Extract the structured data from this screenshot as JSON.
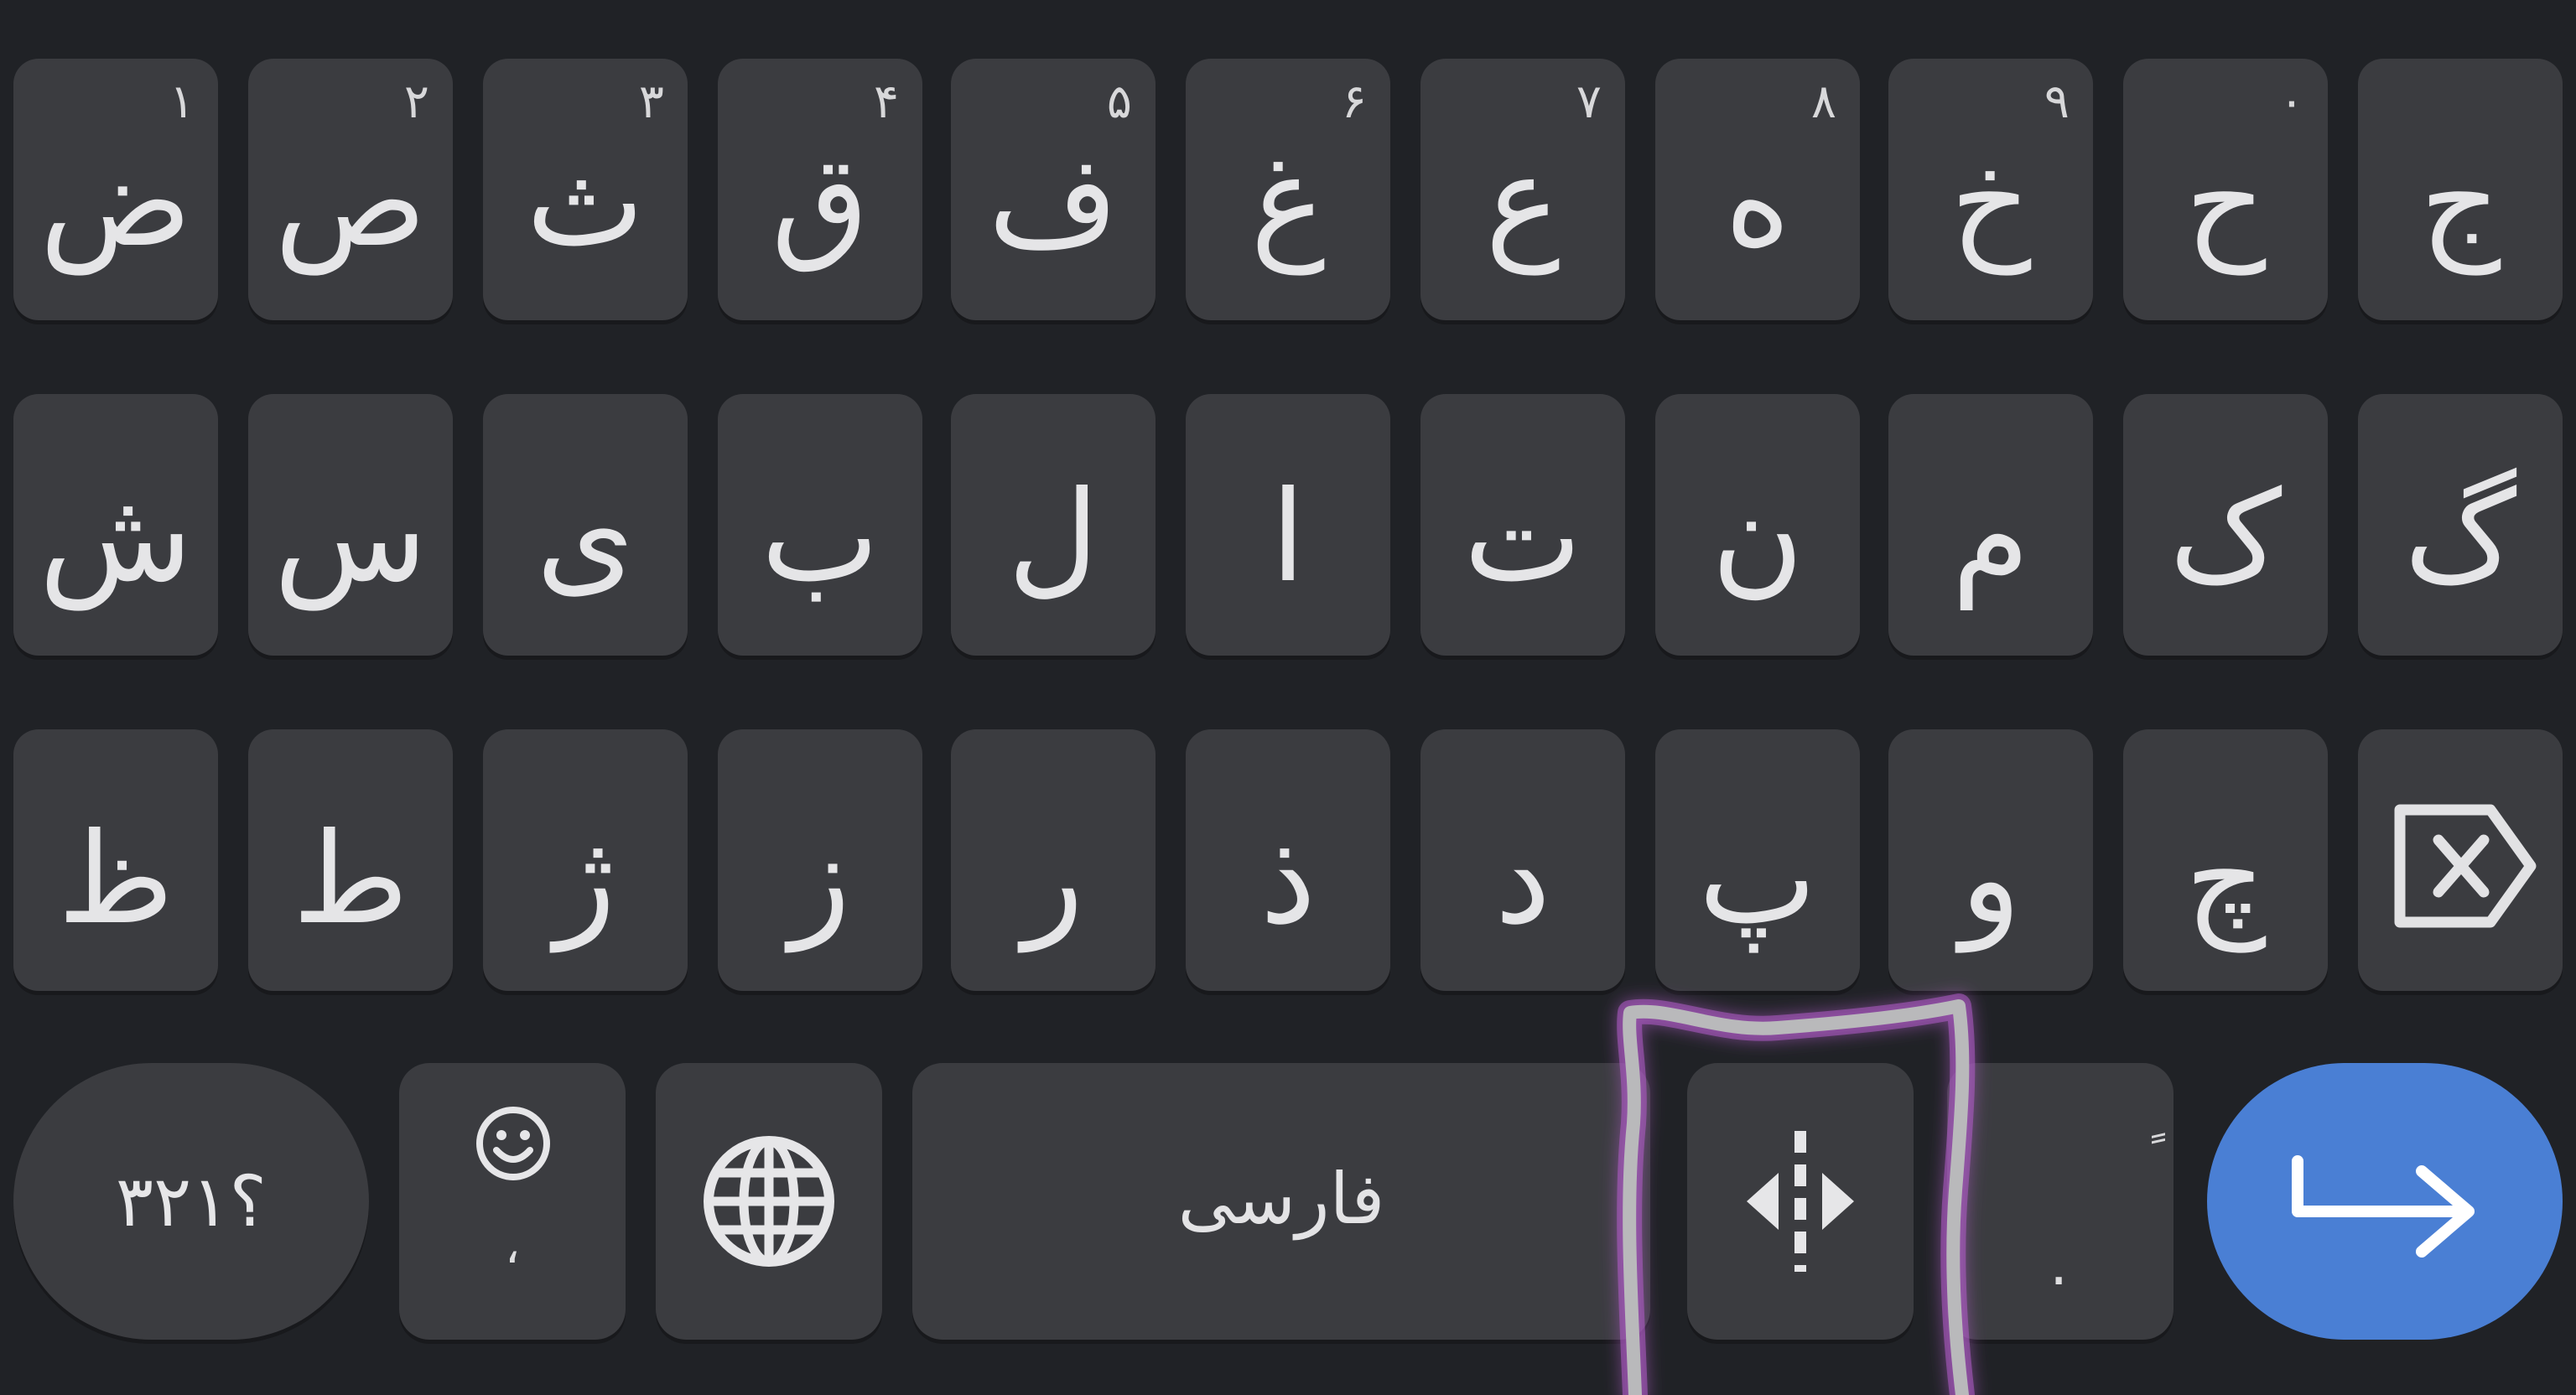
{
  "keyboard": {
    "row1": [
      {
        "char": "ض",
        "hint": "١"
      },
      {
        "char": "ص",
        "hint": "٢"
      },
      {
        "char": "ث",
        "hint": "٣"
      },
      {
        "char": "ق",
        "hint": "۴"
      },
      {
        "char": "ف",
        "hint": "۵"
      },
      {
        "char": "غ",
        "hint": "۶"
      },
      {
        "char": "ع",
        "hint": "٧"
      },
      {
        "char": "ه",
        "hint": "٨"
      },
      {
        "char": "خ",
        "hint": "٩"
      },
      {
        "char": "ح",
        "hint": "٠"
      },
      {
        "char": "ج",
        "hint": ""
      }
    ],
    "row2": [
      {
        "char": "ش"
      },
      {
        "char": "س"
      },
      {
        "char": "ی"
      },
      {
        "char": "ب"
      },
      {
        "char": "ل"
      },
      {
        "char": "ا"
      },
      {
        "char": "ت"
      },
      {
        "char": "ن"
      },
      {
        "char": "م"
      },
      {
        "char": "ک"
      },
      {
        "char": "گ"
      }
    ],
    "row3": [
      {
        "char": "ظ"
      },
      {
        "char": "ط"
      },
      {
        "char": "ژ"
      },
      {
        "char": "ز"
      },
      {
        "char": "ر"
      },
      {
        "char": "ذ"
      },
      {
        "char": "د"
      },
      {
        "char": "پ"
      },
      {
        "char": "و"
      },
      {
        "char": "چ"
      }
    ],
    "bottom": {
      "symbols_label": "؟٣٢١",
      "emoji_sub_label": "،",
      "space_label": "فارسی",
      "period_label": ".",
      "period_hint": "ٍ"
    },
    "icons": {
      "backspace": "backspace-icon",
      "emoji": "emoji-icon",
      "globe": "globe-icon",
      "cursor": "cursor-move-icon",
      "enter": "enter-arrow-icon"
    },
    "colors": {
      "background": "#202226",
      "key": "#3b3c40",
      "key_text": "#e7e7e9",
      "enter": "#4a7fd4",
      "annotation_stroke": "#b9b9bb",
      "annotation_glow": "#b05cc9"
    }
  }
}
